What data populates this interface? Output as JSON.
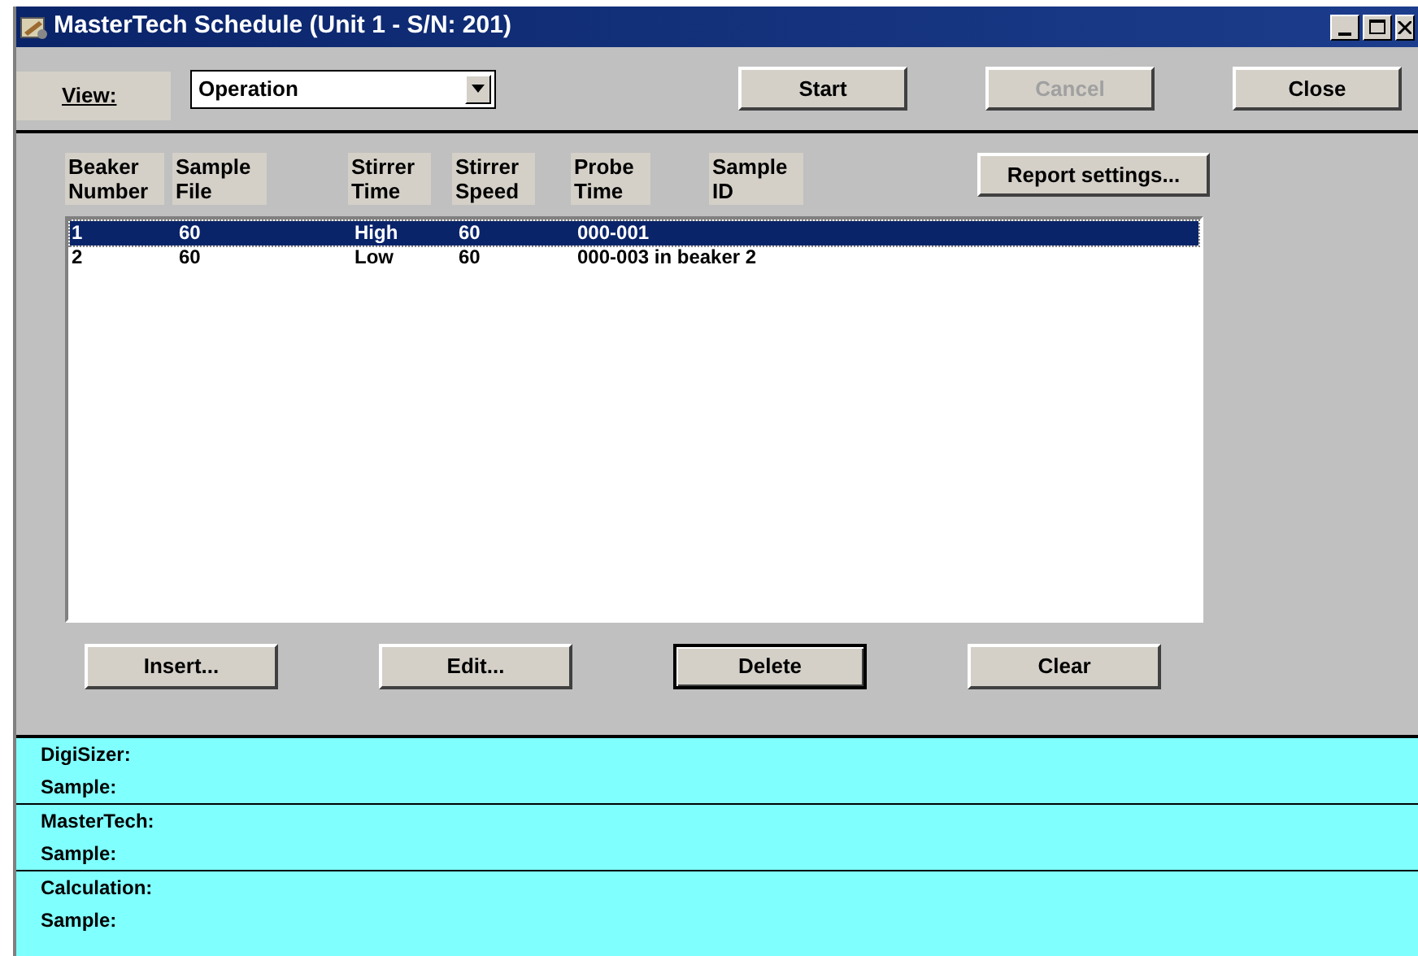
{
  "window": {
    "title": "MasterTech Schedule (Unit 1 - S/N: 201)"
  },
  "toolbar": {
    "view_label": "View:",
    "view_value": "Operation",
    "buttons": [
      {
        "label": "Start",
        "disabled": false
      },
      {
        "label": "Cancel",
        "disabled": true
      },
      {
        "label": "Close",
        "disabled": false
      }
    ]
  },
  "table": {
    "columns": [
      "Beaker Number",
      "Sample File",
      "Stirrer Time",
      "Stirrer Speed",
      "Probe Time",
      "Sample ID"
    ],
    "rows": [
      {
        "cells": [
          "1",
          "60",
          "High",
          "60",
          "000-001",
          ""
        ],
        "selected": true
      },
      {
        "cells": [
          "2",
          "60",
          "Low",
          "60",
          "000-003 in beaker 2",
          ""
        ],
        "selected": false
      }
    ]
  },
  "report_button": "Report settings...",
  "actions": [
    {
      "label": "Insert...",
      "default": false
    },
    {
      "label": "Edit...",
      "default": false
    },
    {
      "label": "Delete",
      "default": true
    },
    {
      "label": "Clear",
      "default": false
    }
  ],
  "status": [
    [
      "DigiSizer:",
      "Sample:"
    ],
    [
      "MasterTech:",
      "Sample:"
    ],
    [
      "Calculation:",
      "Sample:"
    ]
  ]
}
